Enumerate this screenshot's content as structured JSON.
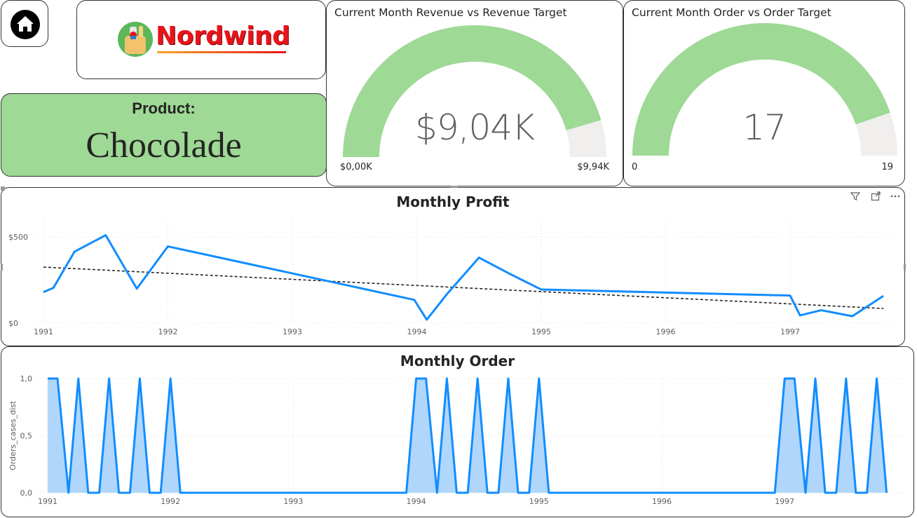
{
  "nav": {
    "home_label": "Home"
  },
  "logo": {
    "text": "Nordwind"
  },
  "product": {
    "label": "Product:",
    "name": "Chocolade"
  },
  "gauges": [
    {
      "title": "Current Month Revenue vs Revenue Target",
      "value_label": "$9,04K",
      "min_label": "$0,00K",
      "max_label": "$9,94K",
      "value": 9.04,
      "min": 0,
      "max": 9.94,
      "fill_color": "#9ed995",
      "track_color": "#f0efee"
    },
    {
      "title": "Current Month Order vs Order Target",
      "value_label": "17",
      "min_label": "0",
      "max_label": "19",
      "value": 17,
      "min": 0,
      "max": 19,
      "fill_color": "#9ed995",
      "track_color": "#f0efee"
    }
  ],
  "profit_chart": {
    "title": "Monthly Profit",
    "line_color": "#118dff",
    "trend_color": "#252423"
  },
  "order_chart": {
    "title": "Monthly Order",
    "line_color": "#118dff",
    "fill_color": "#a7d2fb"
  },
  "chart_data": [
    {
      "type": "line",
      "title": "Monthly Profit",
      "xlabel": "",
      "ylabel": "",
      "x_ticks": [
        "1991",
        "1992",
        "1993",
        "1994",
        "1995",
        "1996",
        "1997"
      ],
      "y_ticks": [
        "$0",
        "$500"
      ],
      "xlim": [
        1991.0,
        1997.8
      ],
      "ylim": [
        0,
        500
      ],
      "series": [
        {
          "x": [
            1991.0,
            1991.08,
            1991.25,
            1991.5,
            1991.75,
            1992.0,
            1993.98,
            1994.08,
            1994.25,
            1994.5,
            1994.75,
            1995.0,
            1997.0,
            1997.08,
            1997.25,
            1997.5,
            1997.75
          ],
          "values": [
            180,
            205,
            415,
            510,
            200,
            445,
            135,
            20,
            175,
            380,
            285,
            195,
            160,
            45,
            75,
            40,
            158
          ]
        }
      ],
      "trendline": {
        "x": [
          1991.0,
          1997.75
        ],
        "values": [
          325,
          85
        ]
      },
      "grid": true
    },
    {
      "type": "area",
      "title": "Monthly Order",
      "xlabel": "",
      "ylabel": "Orders_cases_dist",
      "x_ticks": [
        "1991",
        "1992",
        "1993",
        "1994",
        "1995",
        "1996",
        "1997"
      ],
      "y_ticks": [
        "0,0",
        "0,5",
        "1,0"
      ],
      "xlim": [
        1991.0,
        1997.9
      ],
      "ylim": [
        0,
        1
      ],
      "series": [
        {
          "x": [
            1991.0,
            1991.08,
            1991.17,
            1991.25,
            1991.33,
            1991.42,
            1991.5,
            1991.58,
            1991.67,
            1991.75,
            1991.83,
            1991.92,
            1992.0,
            1992.08,
            1993.92,
            1994.0,
            1994.08,
            1994.17,
            1994.25,
            1994.33,
            1994.42,
            1994.5,
            1994.58,
            1994.67,
            1994.75,
            1994.83,
            1994.92,
            1995.0,
            1995.08,
            1996.92,
            1997.0,
            1997.08,
            1997.17,
            1997.25,
            1997.33,
            1997.42,
            1997.5,
            1997.58,
            1997.67,
            1997.75,
            1997.83
          ],
          "values": [
            1,
            1,
            0,
            1,
            0,
            0,
            1,
            0,
            0,
            1,
            0,
            0,
            1,
            0,
            0,
            1,
            1,
            0,
            1,
            0,
            0,
            1,
            0,
            0,
            1,
            0,
            0,
            1,
            0,
            0,
            1,
            1,
            0,
            1,
            0,
            0,
            1,
            0,
            0,
            1,
            0
          ]
        }
      ],
      "grid": true
    }
  ]
}
